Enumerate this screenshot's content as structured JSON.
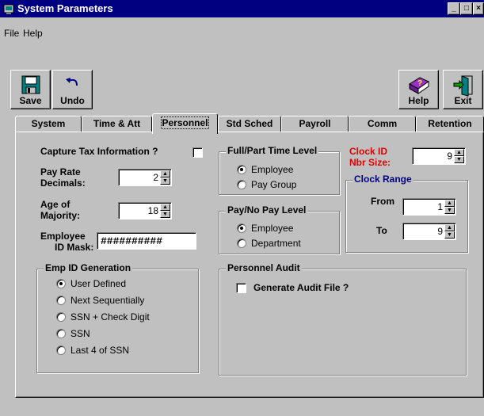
{
  "window": {
    "title": "System Parameters",
    "controls": [
      "_",
      "□",
      "×"
    ]
  },
  "menu": {
    "file": "File",
    "help": "Help"
  },
  "toolbar": {
    "save": "Save",
    "undo": "Undo",
    "help": "Help",
    "exit": "Exit"
  },
  "tabs": [
    "System",
    "Time & Att",
    "Personnel",
    "Std Sched",
    "Payroll",
    "Comm",
    "Retention"
  ],
  "active_tab": "Personnel",
  "personnel": {
    "capture_tax_label": "Capture Tax Information ?",
    "capture_tax_checked": false,
    "pay_rate_decimals_label_1": "Pay Rate",
    "pay_rate_decimals_label_2": "Decimals:",
    "pay_rate_decimals_value": "2",
    "age_of_majority_label_1": "Age of",
    "age_of_majority_label_2": "Majority:",
    "age_of_majority_value": "18",
    "employee_id_mask_label_1": "Employee",
    "employee_id_mask_label_2": "ID Mask:",
    "employee_id_mask_value": "##########",
    "emp_id_generation": {
      "title": "Emp ID Generation",
      "options": [
        "User Defined",
        "Next Sequentially",
        "SSN + Check Digit",
        "SSN",
        "Last 4 of SSN"
      ],
      "selected": "User Defined"
    },
    "full_part_time_level": {
      "title": "Full/Part Time Level",
      "options": [
        "Employee",
        "Pay Group"
      ],
      "selected": "Employee"
    },
    "pay_no_pay_level": {
      "title": "Pay/No Pay Level",
      "options": [
        "Employee",
        "Department"
      ],
      "selected": "Employee"
    },
    "clock_id_label_1": "Clock ID",
    "clock_id_label_2": "Nbr Size:",
    "clock_id_value": "9",
    "clock_range": {
      "title": "Clock Range",
      "from_label": "From",
      "from_value": "1",
      "to_label": "To",
      "to_value": "9"
    },
    "personnel_audit": {
      "title": "Personnel Audit",
      "generate_label": "Generate Audit File ?",
      "generate_checked": false
    }
  },
  "colors": {
    "title_bar": "#000080",
    "clock_id_label": "#e00000",
    "clock_range_title": "#000080"
  }
}
